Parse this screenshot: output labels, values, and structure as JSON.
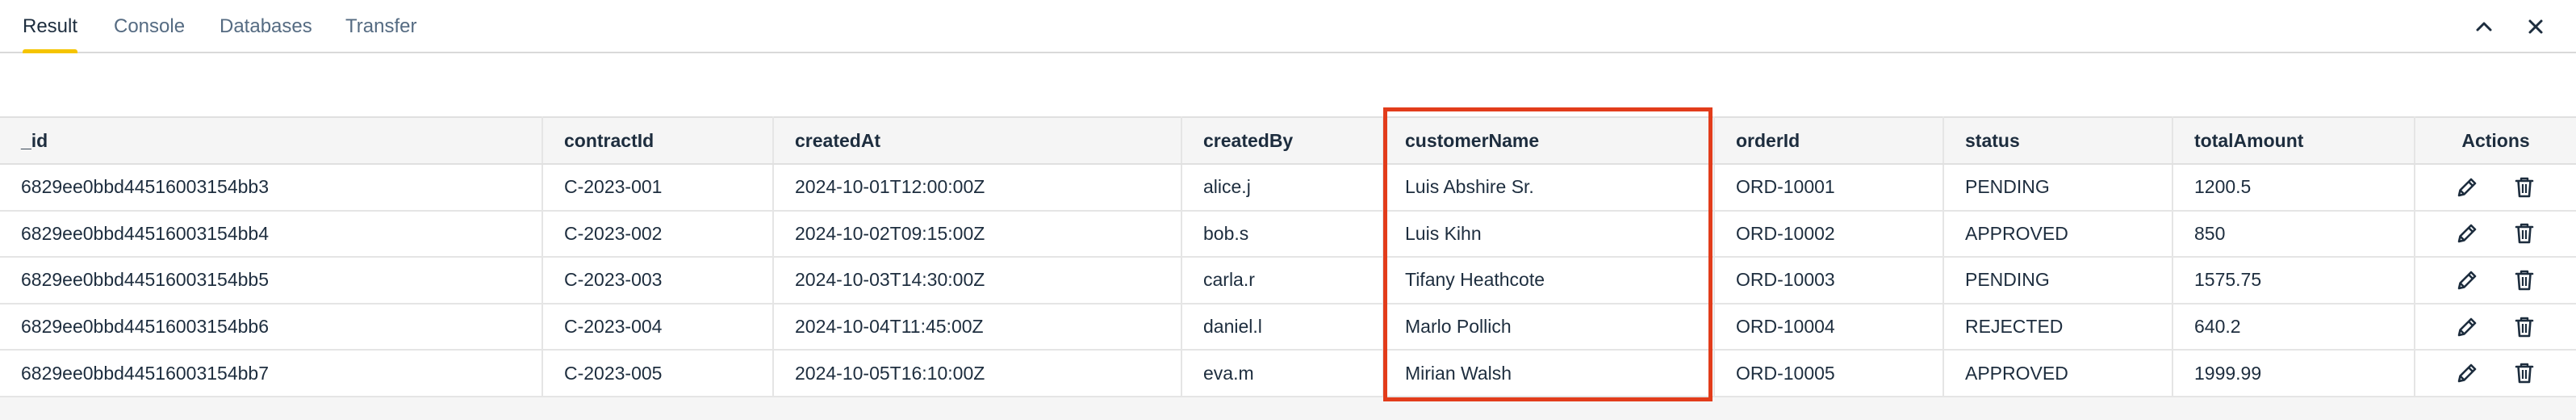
{
  "tabs": [
    {
      "label": "Result",
      "active": true
    },
    {
      "label": "Console",
      "active": false
    },
    {
      "label": "Databases",
      "active": false
    },
    {
      "label": "Transfer",
      "active": false
    }
  ],
  "window_controls": {
    "collapse_icon": "chevron-up-icon",
    "close_icon": "close-icon"
  },
  "table": {
    "columns": [
      "_id",
      "contractId",
      "createdAt",
      "createdBy",
      "customerName",
      "orderId",
      "status",
      "totalAmount",
      "Actions"
    ],
    "rows": [
      [
        "6829ee0bbd44516003154bb3",
        "C-2023-001",
        "2024-10-01T12:00:00Z",
        "alice.j",
        "Luis Abshire Sr.",
        "ORD-10001",
        "PENDING",
        "1200.5"
      ],
      [
        "6829ee0bbd44516003154bb4",
        "C-2023-002",
        "2024-10-02T09:15:00Z",
        "bob.s",
        "Luis Kihn",
        "ORD-10002",
        "APPROVED",
        "850"
      ],
      [
        "6829ee0bbd44516003154bb5",
        "C-2023-003",
        "2024-10-03T14:30:00Z",
        "carla.r",
        "Tifany Heathcote",
        "ORD-10003",
        "PENDING",
        "1575.75"
      ],
      [
        "6829ee0bbd44516003154bb6",
        "C-2023-004",
        "2024-10-04T11:45:00Z",
        "daniel.l",
        "Marlo Pollich",
        "ORD-10004",
        "REJECTED",
        "640.2"
      ],
      [
        "6829ee0bbd44516003154bb7",
        "C-2023-005",
        "2024-10-05T16:10:00Z",
        "eva.m",
        "Mirian Walsh",
        "ORD-10005",
        "APPROVED",
        "1999.99"
      ]
    ],
    "row_actions": [
      "pencil-icon",
      "trash-icon"
    ]
  },
  "colors": {
    "active_tab_indicator": "#f5c400",
    "highlight_border": "#e23c1b",
    "header_background": "#f5f5f5"
  }
}
